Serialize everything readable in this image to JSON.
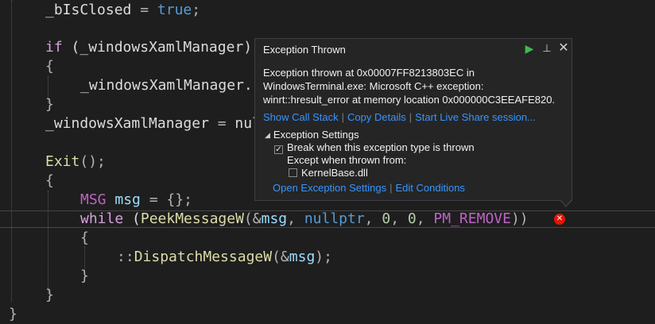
{
  "editor": {
    "lines": [
      {
        "id": "l1",
        "tokens": [
          [
            "plain",
            "_bIsClosed "
          ],
          [
            "punc",
            "="
          ],
          [
            "plain",
            " "
          ],
          [
            "kw",
            "true"
          ],
          [
            "punc",
            ";"
          ]
        ]
      },
      {
        "id": "l2",
        "tokens": [
          [
            "kw2",
            "if"
          ],
          [
            "plain",
            " ("
          ],
          [
            "plain",
            "_windowsXamlManager"
          ],
          [
            "plain",
            ")"
          ]
        ]
      },
      {
        "id": "l3",
        "tokens": [
          [
            "punc",
            "{"
          ]
        ]
      },
      {
        "id": "l4",
        "tokens": [
          [
            "plain",
            "_windowsXamlManager."
          ]
        ]
      },
      {
        "id": "l5",
        "tokens": [
          [
            "punc",
            "}"
          ]
        ]
      },
      {
        "id": "l6",
        "tokens": [
          [
            "plain",
            "_windowsXamlManager "
          ],
          [
            "punc",
            "="
          ],
          [
            "plain",
            " nul"
          ]
        ]
      },
      {
        "id": "l7",
        "tokens": [
          [
            "fn",
            "Exit"
          ],
          [
            "punc",
            "();"
          ]
        ]
      },
      {
        "id": "l8",
        "tokens": [
          [
            "punc",
            "{"
          ]
        ]
      },
      {
        "id": "l9",
        "tokens": [
          [
            "macro",
            "MSG"
          ],
          [
            "plain",
            " "
          ],
          [
            "var",
            "msg"
          ],
          [
            "plain",
            " "
          ],
          [
            "punc",
            "="
          ],
          [
            "plain",
            " "
          ],
          [
            "punc",
            "{};"
          ]
        ]
      },
      {
        "id": "l10",
        "tokens": [
          [
            "kw2",
            "while"
          ],
          [
            "plain",
            " ("
          ],
          [
            "fn",
            "PeekMessageW"
          ],
          [
            "punc",
            "(&"
          ],
          [
            "var",
            "msg"
          ],
          [
            "punc",
            ","
          ],
          [
            "plain",
            " "
          ],
          [
            "kw",
            "nullptr"
          ],
          [
            "punc",
            ","
          ],
          [
            "plain",
            " "
          ],
          [
            "num",
            "0"
          ],
          [
            "punc",
            ","
          ],
          [
            "plain",
            " "
          ],
          [
            "num",
            "0"
          ],
          [
            "punc",
            ","
          ],
          [
            "plain",
            " "
          ],
          [
            "macro",
            "PM_REMOVE"
          ],
          [
            "punc",
            "))"
          ]
        ]
      },
      {
        "id": "l11",
        "tokens": [
          [
            "punc",
            "{"
          ]
        ]
      },
      {
        "id": "l12",
        "tokens": [
          [
            "punc",
            "::"
          ],
          [
            "fn",
            "DispatchMessageW"
          ],
          [
            "punc",
            "(&"
          ],
          [
            "var",
            "msg"
          ],
          [
            "punc",
            ");"
          ]
        ]
      },
      {
        "id": "l13",
        "tokens": [
          [
            "punc",
            "}"
          ]
        ]
      },
      {
        "id": "l14",
        "tokens": [
          [
            "punc",
            "}"
          ]
        ]
      },
      {
        "id": "l15",
        "tokens": [
          [
            "punc",
            "}"
          ]
        ]
      }
    ]
  },
  "error_glyph": "✕",
  "popup": {
    "title": "Exception Thrown",
    "controls": {
      "continue_icon": "▶",
      "pin_icon": "⊥",
      "close_icon": "✕"
    },
    "message_lines": [
      "Exception thrown at 0x00007FF8213803EC in",
      "WindowsTerminal.exe: Microsoft C++ exception:",
      "winrt::hresult_error at memory location 0x000000C3EEAFE820."
    ],
    "links": [
      "Show Call Stack",
      "Copy Details",
      "Start Live Share session..."
    ],
    "settings": {
      "header": "Exception Settings",
      "break_label": "Break when this exception type is thrown",
      "break_checked": true,
      "except_label": "Except when thrown from:",
      "module_label": "KernelBase.dll",
      "module_checked": false
    },
    "bottom_links": [
      "Open Exception Settings",
      "Edit Conditions"
    ]
  },
  "colors": {
    "accent": "#3794ff",
    "error": "#e51400",
    "continue": "#3fb950"
  }
}
